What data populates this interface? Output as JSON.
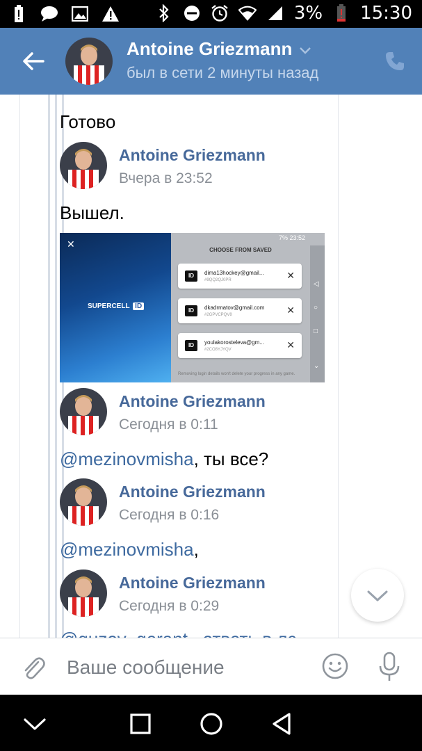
{
  "status_bar": {
    "battery": "3%",
    "time": "15:30"
  },
  "header": {
    "name": "Antoine Griezmann",
    "status": "был в сети 2 минуты назад"
  },
  "messages": {
    "m0_text": "Готово",
    "m1_author": "Antoine Griezmann",
    "m1_time": "Вчера в 23:52",
    "m1_text": "Вышел.",
    "m2_author": "Antoine Griezmann",
    "m2_time": "Сегодня в 0:11",
    "m2_mention": "@mezinovmisha",
    "m2_rest": ", ты все?",
    "m3_author": "Antoine Griezmann",
    "m3_time": "Сегодня в 0:16",
    "m3_mention": "@mezinovmisha",
    "m3_rest": ",",
    "m4_author": "Antoine Griezmann",
    "m4_time": "Сегодня в 0:29",
    "m4_partial": "@guzov_gerant , ответь в лс"
  },
  "attachment": {
    "status_time": "7%  23:52",
    "title": "CHOOSE FROM SAVED",
    "brand": "SUPERCELL",
    "brand_id": "ID",
    "accounts": [
      {
        "email": "dima13hockey@gmail...",
        "code": "#9QQ2QJ0PR"
      },
      {
        "email": "dkadrmatov@gmail.com",
        "code": "#2GPVCPQV8"
      },
      {
        "email": "youlakorosteleva@gm...",
        "code": "#2CO8YJYQV"
      }
    ],
    "footer": "Removing login details won't delete your progress in any game."
  },
  "input": {
    "placeholder": "Ваше сообщение"
  },
  "colors": {
    "header": "#5181b8",
    "link": "#3e6aa0",
    "author": "#47699a"
  }
}
